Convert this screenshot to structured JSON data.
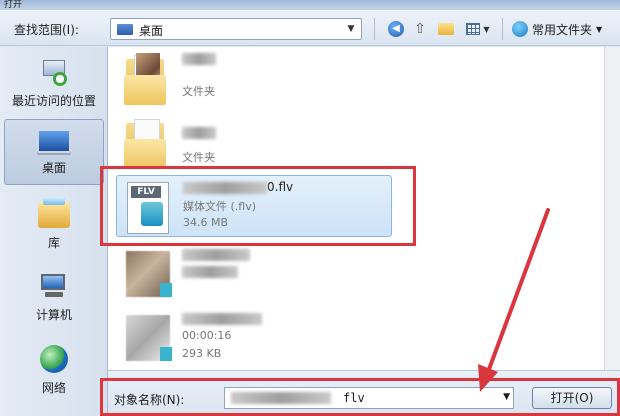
{
  "window": {
    "title": "打开"
  },
  "toolbar": {
    "look_in_label": "查找范围(I):",
    "look_in_value": "桌面",
    "common_folders_label": "常用文件夹"
  },
  "places": [
    {
      "label": "最近访问的位置",
      "icon": "recent-places-icon",
      "selected": false
    },
    {
      "label": "桌面",
      "icon": "desktop-icon",
      "selected": true
    },
    {
      "label": "库",
      "icon": "libraries-icon",
      "selected": false
    },
    {
      "label": "计算机",
      "icon": "computer-icon",
      "selected": false
    },
    {
      "label": "网络",
      "icon": "network-icon",
      "selected": false
    }
  ],
  "files": [
    {
      "name": "",
      "type": "文件夹",
      "detail": "",
      "kind": "folder-photo"
    },
    {
      "name": "",
      "type": "文件夹",
      "detail": "",
      "kind": "folder"
    },
    {
      "name": "0.flv",
      "type": "媒体文件 (.flv)",
      "detail": "34.6 MB",
      "kind": "flv",
      "selected": true
    },
    {
      "name": "",
      "type": "",
      "detail": "",
      "kind": "media"
    },
    {
      "name": "",
      "type": "00:00:16",
      "detail": "293 KB",
      "kind": "media"
    }
  ],
  "bottom": {
    "filename_label": "对象名称(N):",
    "filename_ext": "flv",
    "open_label": "打开(O)"
  },
  "annotations": {
    "highlight_color": "#d9363e"
  }
}
